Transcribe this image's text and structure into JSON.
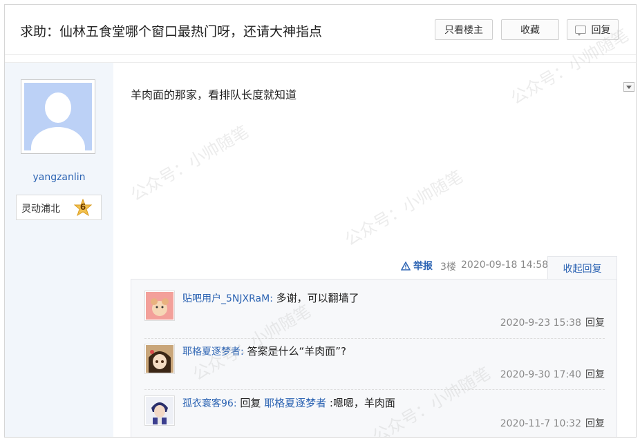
{
  "thread": {
    "title": "求助：仙林五食堂哪个窗口最热门呀，还请大神指点",
    "buttons": {
      "only_lz": "只看楼主",
      "favorite": "收藏",
      "reply": "回复"
    }
  },
  "author": {
    "name": "yangzanlin",
    "badge_name": "灵动浦北",
    "level": "6"
  },
  "post": {
    "content": "羊肉面的那家，看排队长度就知道",
    "report": "举报",
    "floor": "3楼",
    "time": "2020-09-18 14:58",
    "collapse_reply": "收起回复"
  },
  "comments": [
    {
      "user": "贴吧用户_5NJXRaM",
      "sep": ":",
      "text": " 多谢，可以翻墙了",
      "time": "2020-9-23 15:38",
      "reply": "回复"
    },
    {
      "user": "耶格夏逐梦者",
      "sep": ":",
      "text": " 答案是什么“羊肉面”?",
      "time": "2020-9-30 17:40",
      "reply": "回复"
    },
    {
      "user": "孤衣寰客96",
      "sep": ":",
      "prefix": " 回复 ",
      "mention": "耶格夏逐梦者",
      "text": " :嗯嗯，羊肉面",
      "time": "2020-11-7 10:32",
      "reply": "回复"
    }
  ],
  "watermark": "公众号：小帅随笔",
  "colors": {
    "link": "#2d64b3",
    "sidebar_bg": "#f2f6fb",
    "avatar_bg": "#bcd1f6"
  }
}
